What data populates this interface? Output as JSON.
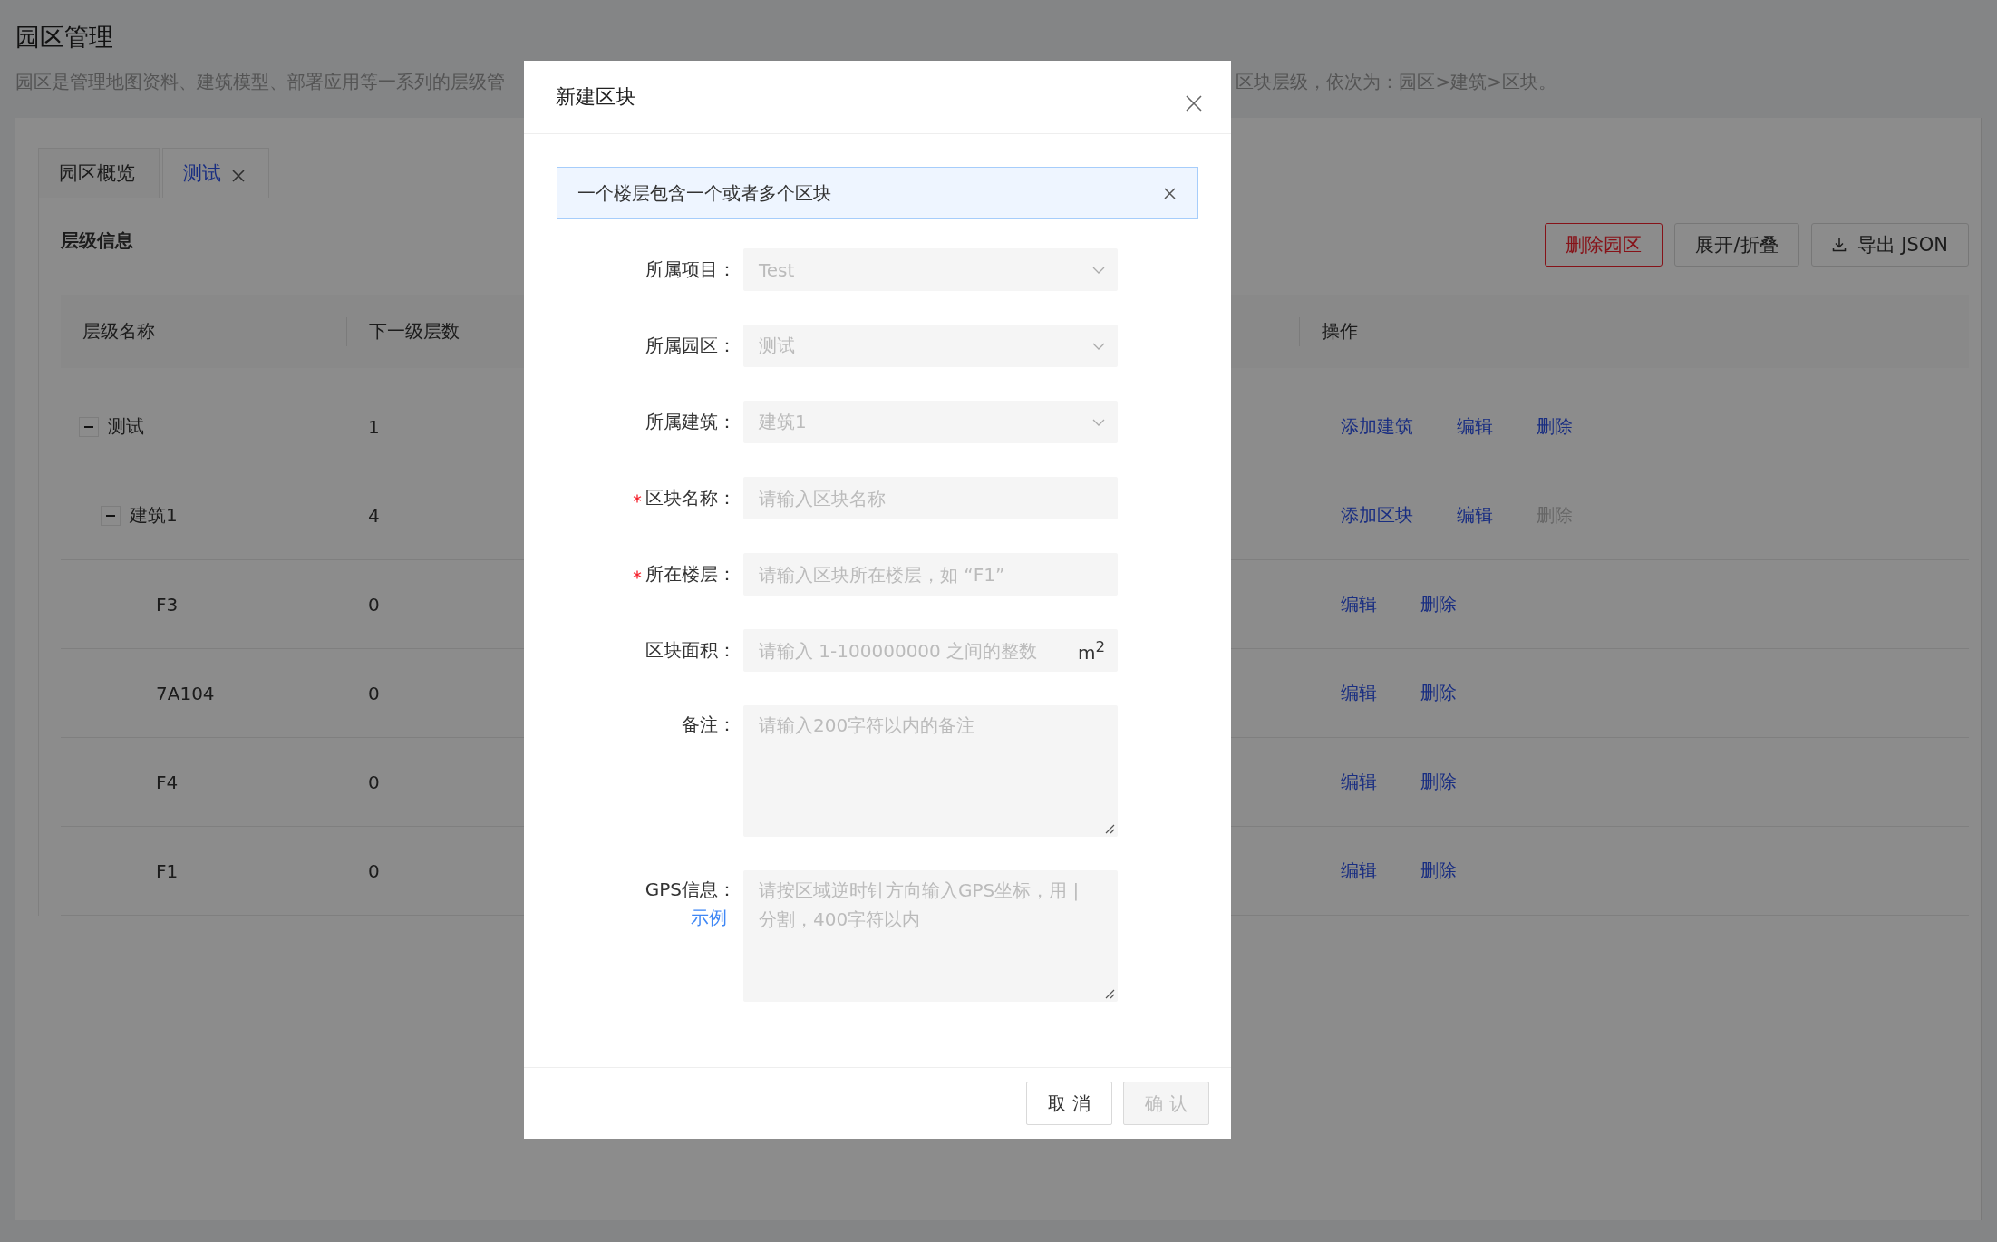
{
  "page": {
    "title": "园区管理",
    "description_left": "园区是管理地图资料、建筑模型、部署应用等一系列的层级管",
    "description_right": "区块层级，依次为：园区>建筑>区块。"
  },
  "tabs": [
    {
      "label": "园区概览",
      "selected": false,
      "closable": false
    },
    {
      "label": "测试",
      "selected": true,
      "closable": true
    }
  ],
  "section_title": "层级信息",
  "toolbar_buttons": [
    {
      "label": "删除园区",
      "kind": "danger"
    },
    {
      "label": "展开/折叠",
      "kind": "default"
    },
    {
      "label": "导出 JSON",
      "kind": "download"
    }
  ],
  "table": {
    "columns": [
      "层级名称",
      "下一级层数",
      "操作"
    ],
    "rows": [
      {
        "name": "测试",
        "child_count": "1",
        "expanded": true,
        "actions": [
          {
            "label": "添加建筑",
            "disabled": false
          },
          {
            "label": "编辑",
            "disabled": false
          },
          {
            "label": "删除",
            "disabled": false
          }
        ],
        "children": [
          {
            "name": "建筑1",
            "child_count": "4",
            "expanded": true,
            "actions": [
              {
                "label": "添加区块",
                "disabled": false
              },
              {
                "label": "编辑",
                "disabled": false
              },
              {
                "label": "删除",
                "disabled": true
              }
            ],
            "children": [
              {
                "name": "F3",
                "child_count": "0",
                "actions": [
                  {
                    "label": "编辑",
                    "disabled": false
                  },
                  {
                    "label": "删除",
                    "disabled": false
                  }
                ]
              },
              {
                "name": "7A104",
                "child_count": "0",
                "actions": [
                  {
                    "label": "编辑",
                    "disabled": false
                  },
                  {
                    "label": "删除",
                    "disabled": false
                  }
                ]
              },
              {
                "name": "F4",
                "child_count": "0",
                "actions": [
                  {
                    "label": "编辑",
                    "disabled": false
                  },
                  {
                    "label": "删除",
                    "disabled": false
                  }
                ]
              },
              {
                "name": "F1",
                "child_count": "0",
                "actions": [
                  {
                    "label": "编辑",
                    "disabled": false
                  },
                  {
                    "label": "删除",
                    "disabled": false
                  }
                ]
              }
            ]
          }
        ]
      }
    ]
  },
  "dialog": {
    "title": "新建区块",
    "alert": {
      "text": "一个楼层包含一个或者多个区块",
      "closable": true
    },
    "fields": [
      {
        "label": "所属项目：",
        "kind": "select",
        "required": false,
        "disabled": true,
        "value": "Test"
      },
      {
        "label": "所属园区：",
        "kind": "select",
        "required": false,
        "disabled": true,
        "value": "测试"
      },
      {
        "label": "所属建筑：",
        "kind": "select",
        "required": false,
        "disabled": true,
        "value": "建筑1"
      },
      {
        "label": "区块名称：",
        "kind": "input",
        "required": true,
        "placeholder": "请输入区块名称"
      },
      {
        "label": "所在楼层：",
        "kind": "input",
        "required": true,
        "placeholder": "请输入区块所在楼层，如 “F1”"
      },
      {
        "label": "区块面积：",
        "kind": "input",
        "required": false,
        "placeholder": "请输入 1-100000000 之间的整数",
        "unit": "m$^{2}$"
      },
      {
        "label": "备注：",
        "kind": "textarea",
        "required": false,
        "placeholder": "请输入200字符以内的备注"
      },
      {
        "label": "GPS信息：",
        "kind": "textarea",
        "required": false,
        "link": "示例",
        "placeholder": "请按区域逆时针方向输入GPS坐标，用 | 分割，400字符以内"
      }
    ],
    "buttons": [
      {
        "label": "取 消",
        "disabled": false
      },
      {
        "label": "确 认",
        "disabled": true
      }
    ]
  }
}
